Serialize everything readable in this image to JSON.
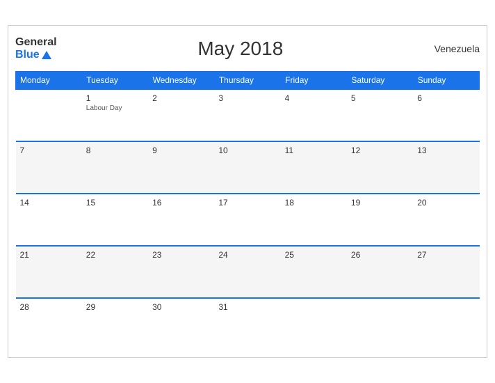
{
  "header": {
    "logo_general": "General",
    "logo_blue": "Blue",
    "title": "May 2018",
    "country": "Venezuela"
  },
  "weekdays": [
    "Monday",
    "Tuesday",
    "Wednesday",
    "Thursday",
    "Friday",
    "Saturday",
    "Sunday"
  ],
  "weeks": [
    [
      {
        "day": "",
        "holiday": ""
      },
      {
        "day": "1",
        "holiday": "Labour Day"
      },
      {
        "day": "2",
        "holiday": ""
      },
      {
        "day": "3",
        "holiday": ""
      },
      {
        "day": "4",
        "holiday": ""
      },
      {
        "day": "5",
        "holiday": ""
      },
      {
        "day": "6",
        "holiday": ""
      }
    ],
    [
      {
        "day": "7",
        "holiday": ""
      },
      {
        "day": "8",
        "holiday": ""
      },
      {
        "day": "9",
        "holiday": ""
      },
      {
        "day": "10",
        "holiday": ""
      },
      {
        "day": "11",
        "holiday": ""
      },
      {
        "day": "12",
        "holiday": ""
      },
      {
        "day": "13",
        "holiday": ""
      }
    ],
    [
      {
        "day": "14",
        "holiday": ""
      },
      {
        "day": "15",
        "holiday": ""
      },
      {
        "day": "16",
        "holiday": ""
      },
      {
        "day": "17",
        "holiday": ""
      },
      {
        "day": "18",
        "holiday": ""
      },
      {
        "day": "19",
        "holiday": ""
      },
      {
        "day": "20",
        "holiday": ""
      }
    ],
    [
      {
        "day": "21",
        "holiday": ""
      },
      {
        "day": "22",
        "holiday": ""
      },
      {
        "day": "23",
        "holiday": ""
      },
      {
        "day": "24",
        "holiday": ""
      },
      {
        "day": "25",
        "holiday": ""
      },
      {
        "day": "26",
        "holiday": ""
      },
      {
        "day": "27",
        "holiday": ""
      }
    ],
    [
      {
        "day": "28",
        "holiday": ""
      },
      {
        "day": "29",
        "holiday": ""
      },
      {
        "day": "30",
        "holiday": ""
      },
      {
        "day": "31",
        "holiday": ""
      },
      {
        "day": "",
        "holiday": ""
      },
      {
        "day": "",
        "holiday": ""
      },
      {
        "day": "",
        "holiday": ""
      }
    ]
  ]
}
